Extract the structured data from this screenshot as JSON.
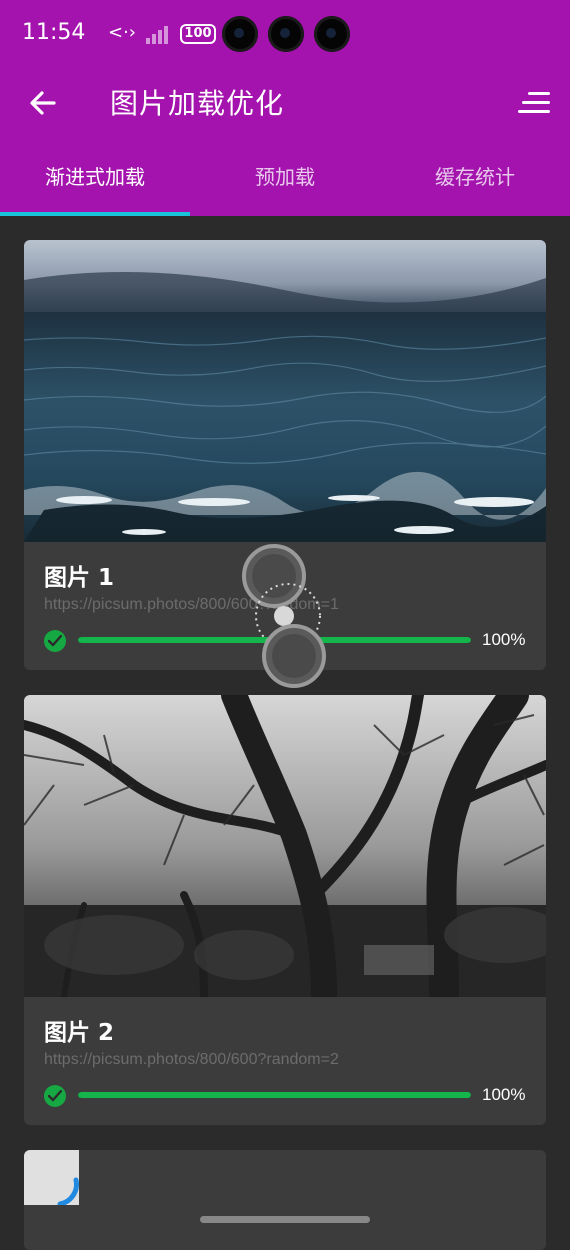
{
  "status": {
    "time": "11:54",
    "network_glyph": "<·›",
    "battery": "100"
  },
  "toolbar": {
    "title": "图片加载优化",
    "back_icon": "arrow-left-icon",
    "menu_icon": "sort-menu-icon"
  },
  "tabs": [
    {
      "label": "渐进式加载",
      "active": true
    },
    {
      "label": "预加载",
      "active": false
    },
    {
      "label": "缓存统计",
      "active": false
    }
  ],
  "colors": {
    "appbar": "#a413ad",
    "indicator": "#19c3d8",
    "progress": "#14b54a",
    "background": "#2b2b2b",
    "card": "#3c3c3c"
  },
  "images": [
    {
      "title": "图片 1",
      "url": "https://picsum.photos/800/600?random=1",
      "progress_label": "100%",
      "progress": 1.0
    },
    {
      "title": "图片 2",
      "url": "https://picsum.photos/800/600?random=2",
      "progress_label": "100%",
      "progress": 1.0
    }
  ]
}
